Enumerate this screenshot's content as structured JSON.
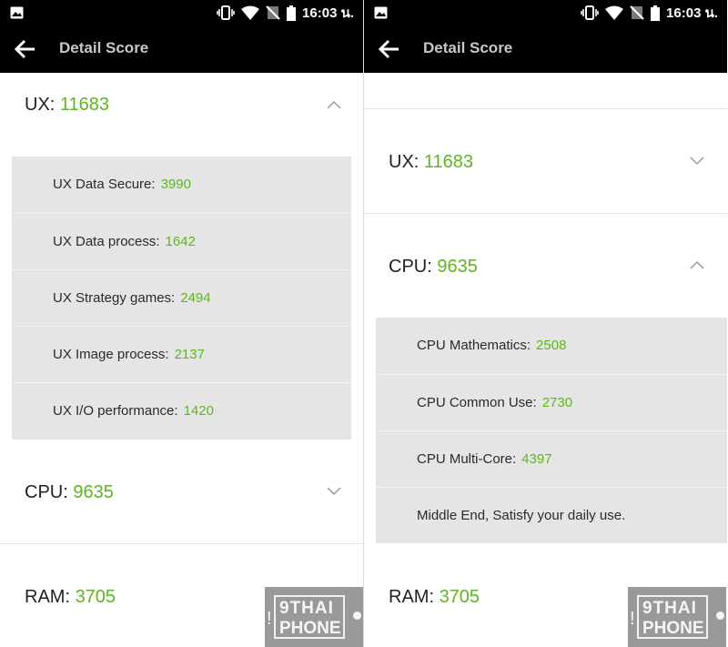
{
  "status_bar": {
    "time": "16:03 น."
  },
  "app_bar": {
    "title": "Detail Score"
  },
  "left_pane": {
    "ux": {
      "label": "UX:",
      "score": "11683",
      "state": "expanded"
    },
    "ux_items": [
      {
        "label": "UX Data Secure:",
        "value": "3990"
      },
      {
        "label": "UX Data process:",
        "value": "1642"
      },
      {
        "label": "UX Strategy games:",
        "value": "2494"
      },
      {
        "label": "UX Image process:",
        "value": "2137"
      },
      {
        "label": "UX I/O performance:",
        "value": "1420"
      }
    ],
    "cpu": {
      "label": "CPU:",
      "score": "9635",
      "state": "collapsed"
    },
    "ram": {
      "label": "RAM:",
      "score": "3705"
    }
  },
  "right_pane": {
    "ux": {
      "label": "UX:",
      "score": "11683",
      "state": "collapsed"
    },
    "cpu": {
      "label": "CPU:",
      "score": "9635",
      "state": "expanded"
    },
    "cpu_items": [
      {
        "label": "CPU Mathematics:",
        "value": "2508"
      },
      {
        "label": "CPU Common Use:",
        "value": "2730"
      },
      {
        "label": "CPU Multi-Core:",
        "value": "4397"
      }
    ],
    "cpu_note": "Middle End, Satisfy your daily use.",
    "ram": {
      "label": "RAM:",
      "score": "3705"
    }
  },
  "watermark": {
    "line1": "9THAI",
    "line2": "PHONE",
    "mark": "!"
  },
  "colors": {
    "score_green": "#5db61c",
    "bar_black": "#000000",
    "sub_panel_grey": "#e5e5e5"
  },
  "icons": [
    "gallery-icon",
    "vibrate-icon",
    "wifi-icon",
    "no-sim-icon",
    "battery-icon",
    "back-arrow-icon",
    "chevron-up-icon",
    "chevron-down-icon"
  ]
}
